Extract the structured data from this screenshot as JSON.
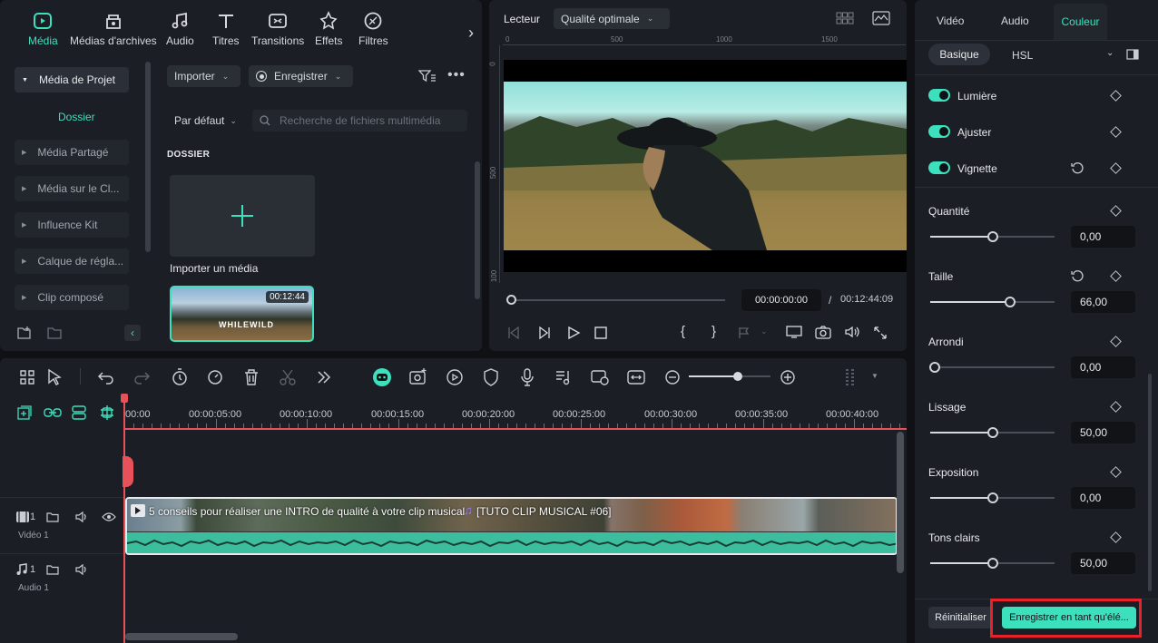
{
  "colors": {
    "accent": "#3ce0bd",
    "highlight": "#e8212b",
    "playhead": "#e8515a"
  },
  "top_tabs": [
    {
      "label": "Média",
      "icon": "media-icon"
    },
    {
      "label": "Médias d'archives",
      "icon": "stock-media-icon"
    },
    {
      "label": "Audio",
      "icon": "music-note-icon"
    },
    {
      "label": "Titres",
      "icon": "text-t-icon"
    },
    {
      "label": "Transitions",
      "icon": "transition-icon"
    },
    {
      "label": "Effets",
      "icon": "effects-icon"
    },
    {
      "label": "Filtres",
      "icon": "filter-icon"
    }
  ],
  "sidebar": {
    "project_media": "Média de Projet",
    "folder": "Dossier",
    "items": [
      "Média Partagé",
      "Média sur le Cl...",
      "Influence Kit",
      "Calque de régla...",
      "Clip composé"
    ]
  },
  "media": {
    "import": "Importer",
    "record": "Enregistrer",
    "sort": "Par défaut",
    "search_placeholder": "Recherche de fichiers multimédia",
    "section": "DOSSIER",
    "import_media": "Importer un média",
    "clip_duration": "00:12:44",
    "clip_brand": "WHILEWILD"
  },
  "player": {
    "label": "Lecteur",
    "quality": "Qualité optimale",
    "ruler_top": [
      "0",
      "500",
      "1000",
      "1500"
    ],
    "ruler_left": [
      "0",
      "500",
      "100"
    ],
    "current_time": "00:00:00:00",
    "separator": "/",
    "total_time": "00:12:44:09",
    "progress": 0
  },
  "timeline": {
    "ruler": [
      "00:00",
      "00:00:05:00",
      "00:00:10:00",
      "00:00:15:00",
      "00:00:20:00",
      "00:00:25:00",
      "00:00:30:00",
      "00:00:35:00",
      "00:00:40:00"
    ],
    "video_track": "Vidéo 1",
    "audio_track": "Audio 1",
    "track_num": "1",
    "clip_title": "5 conseils pour réaliser une INTRO de qualité à votre clip musical",
    "clip_title2": "[TUTO CLIP MUSICAL #06]",
    "zoom": 0.6
  },
  "right": {
    "tabs": [
      "Vidéo",
      "Audio",
      "Couleur"
    ],
    "subtabs": [
      "Basique",
      "HSL"
    ],
    "toggles": [
      "Lumière",
      "Ajuster",
      "Vignette"
    ],
    "params": [
      {
        "label": "Quantité",
        "value": "0,00",
        "level": 0.5
      },
      {
        "label": "Taille",
        "value": "66,00",
        "level": 0.64
      },
      {
        "label": "Arrondi",
        "value": "0,00",
        "level": 0.04
      },
      {
        "label": "Lissage",
        "value": "50,00",
        "level": 0.5
      },
      {
        "label": "Exposition",
        "value": "0,00",
        "level": 0.5
      },
      {
        "label": "Tons clairs",
        "value": "50,00",
        "level": 0.5
      }
    ],
    "reset": "Réinitialiser",
    "save_preset": "Enregistrer en tant qu'élé..."
  }
}
